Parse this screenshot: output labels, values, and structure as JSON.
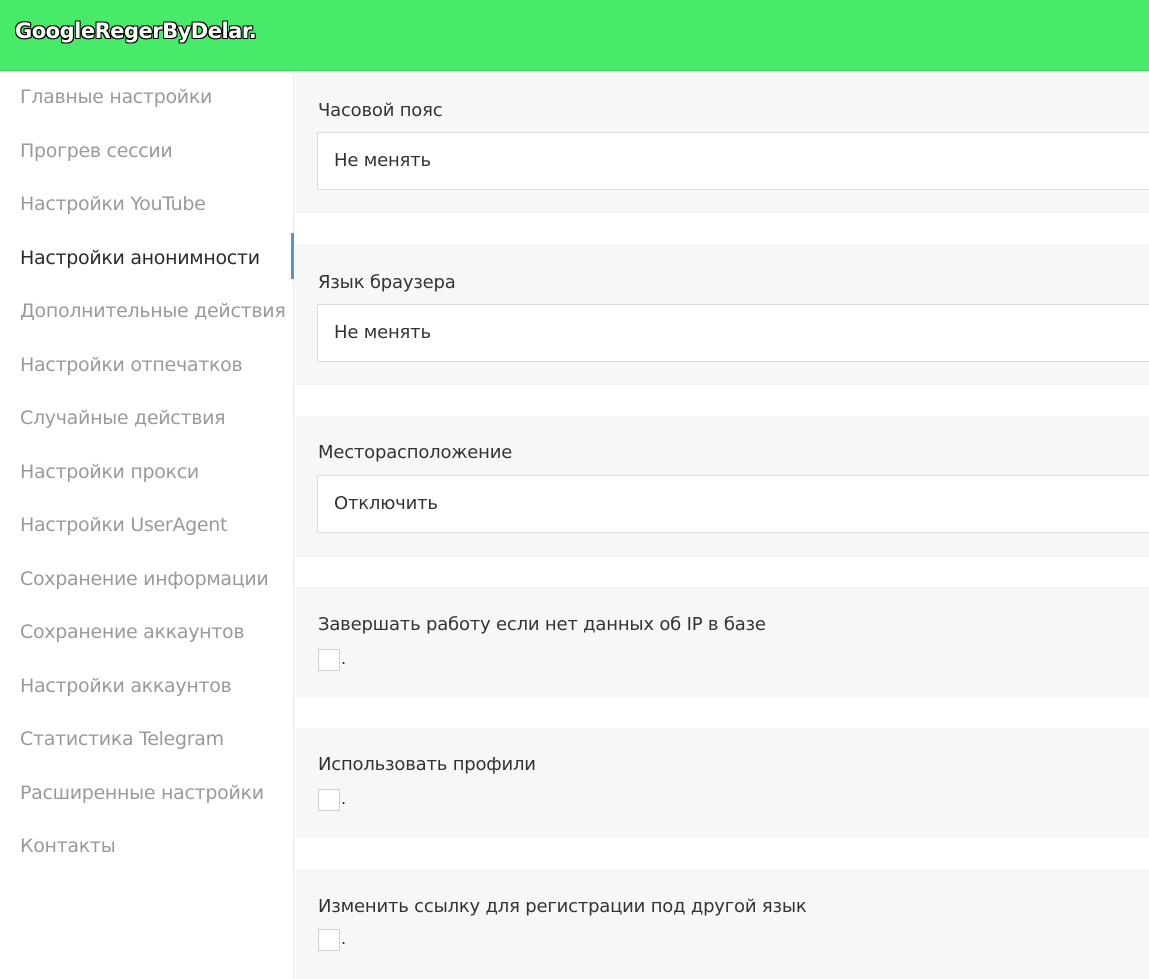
{
  "header": {
    "title": "GoogleRegerByDelar.",
    "background_color": "#48ea6a"
  },
  "sidebar": {
    "active_index": 3,
    "items": [
      {
        "label": "Главные настройки"
      },
      {
        "label": "Прогрев сессии"
      },
      {
        "label": "Настройки YouTube"
      },
      {
        "label": "Настройки анонимности"
      },
      {
        "label": "Дополнительные действия"
      },
      {
        "label": "Настройки отпечатков"
      },
      {
        "label": "Случайные действия"
      },
      {
        "label": "Настройки прокси"
      },
      {
        "label": "Настройки UserAgent"
      },
      {
        "label": "Сохранение информации"
      },
      {
        "label": "Сохранение аккаунтов"
      },
      {
        "label": "Настройки аккаунтов"
      },
      {
        "label": "Статистика Telegram"
      },
      {
        "label": "Расширенные настройки"
      },
      {
        "label": "Контакты"
      }
    ]
  },
  "settings": {
    "timezone": {
      "label": "Часовой пояс",
      "value": "Не менять"
    },
    "browser_language": {
      "label": "Язык браузера",
      "value": "Не менять"
    },
    "location": {
      "label": "Месторасположение",
      "value": "Отключить"
    },
    "stop_if_no_ip_data": {
      "label": "Завершать работу если нет данных об IP в базе",
      "checked": false,
      "suffix": "."
    },
    "use_profiles": {
      "label": "Использовать профили",
      "checked": false,
      "suffix": "."
    },
    "change_registration_link": {
      "label": "Изменить ссылку для регистрации под другой язык",
      "checked": false,
      "suffix": "."
    }
  }
}
